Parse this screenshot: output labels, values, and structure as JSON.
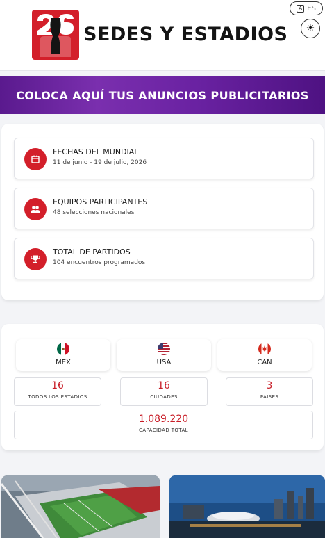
{
  "header": {
    "logo_alt": "26",
    "title": "SEDES Y ESTADIOS",
    "language": "ES"
  },
  "ad": {
    "text": "COLOCA AQUÍ TUS ANUNCIOS PUBLICITARIOS"
  },
  "info": [
    {
      "icon": "calendar-icon",
      "title": "FECHAS DEL MUNDIAL",
      "subtitle": "11 de junio - 19 de julio, 2026"
    },
    {
      "icon": "teams-icon",
      "title": "EQUIPOS PARTICIPANTES",
      "subtitle": "48 selecciones nacionales"
    },
    {
      "icon": "trophy-icon",
      "title": "TOTAL DE PARTIDOS",
      "subtitle": "104 encuentros programados"
    }
  ],
  "countries": [
    {
      "code": "MEX",
      "flag": "mexico-flag-icon"
    },
    {
      "code": "USA",
      "flag": "usa-flag-icon"
    },
    {
      "code": "CAN",
      "flag": "canada-flag-icon"
    }
  ],
  "stats": {
    "stadiums": {
      "value": "16",
      "label": "TODOS LOS ESTADIOS"
    },
    "cities": {
      "value": "16",
      "label": "CIUDADES"
    },
    "countries": {
      "value": "3",
      "label": "PAISES"
    },
    "capacity": {
      "value": "1.089.220",
      "label": "CAPACIDAD TOTAL"
    }
  },
  "colors": {
    "accent_red": "#d31f2a",
    "banner_purple": "#6a22a2"
  }
}
